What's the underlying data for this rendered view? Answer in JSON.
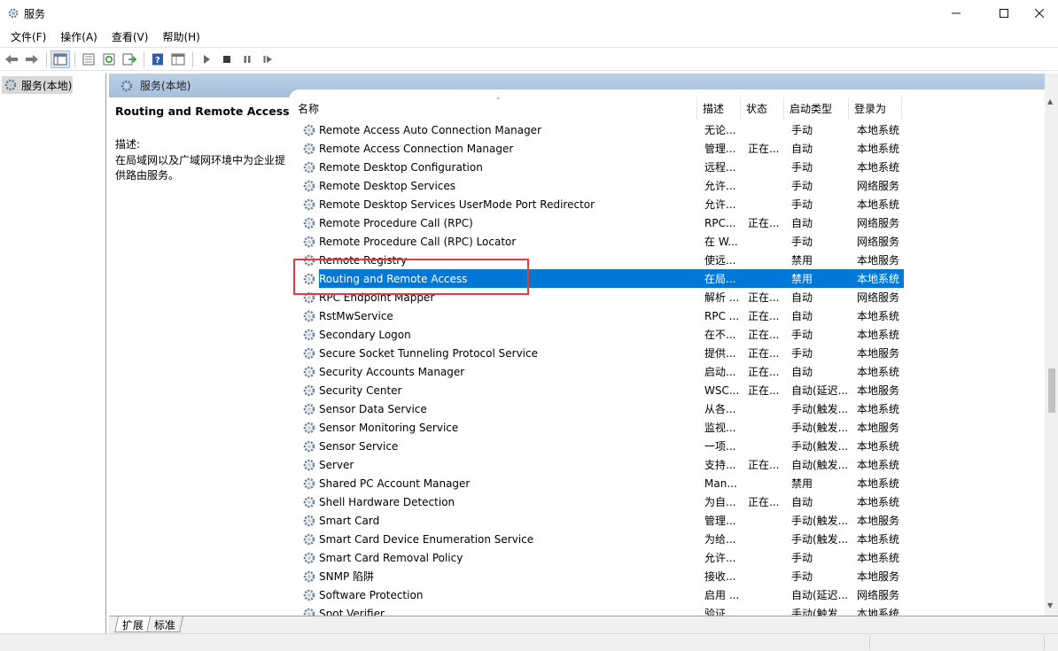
{
  "window": {
    "title": "服务"
  },
  "menu": [
    "文件(F)",
    "操作(A)",
    "查看(V)",
    "帮助(H)"
  ],
  "tree": {
    "root_label": "服务(本地)"
  },
  "pane": {
    "header": "服务(本地)"
  },
  "description": {
    "service_name": "Routing and Remote Access",
    "label": "描述:",
    "text": "在局域网以及广域网环境中为企业提供路由服务。"
  },
  "columns": {
    "name": "名称",
    "desc": "描述",
    "status": "状态",
    "startup": "启动类型",
    "logon": "登录为"
  },
  "services": [
    {
      "name": "Remote Access Auto Connection Manager",
      "desc": "无论...",
      "status": "",
      "startup": "手动",
      "logon": "本地系统"
    },
    {
      "name": "Remote Access Connection Manager",
      "desc": "管理...",
      "status": "正在...",
      "startup": "自动",
      "logon": "本地系统"
    },
    {
      "name": "Remote Desktop Configuration",
      "desc": "远程...",
      "status": "",
      "startup": "手动",
      "logon": "本地系统"
    },
    {
      "name": "Remote Desktop Services",
      "desc": "允许...",
      "status": "",
      "startup": "手动",
      "logon": "网络服务"
    },
    {
      "name": "Remote Desktop Services UserMode Port Redirector",
      "desc": "允许...",
      "status": "",
      "startup": "手动",
      "logon": "本地系统"
    },
    {
      "name": "Remote Procedure Call (RPC)",
      "desc": "RPC...",
      "status": "正在...",
      "startup": "自动",
      "logon": "网络服务"
    },
    {
      "name": "Remote Procedure Call (RPC) Locator",
      "desc": "在 W...",
      "status": "",
      "startup": "手动",
      "logon": "网络服务"
    },
    {
      "name": "Remote Registry",
      "desc": "使远...",
      "status": "",
      "startup": "禁用",
      "logon": "本地服务"
    },
    {
      "name": "Routing and Remote Access",
      "desc": "在局...",
      "status": "",
      "startup": "禁用",
      "logon": "本地系统"
    },
    {
      "name": "RPC Endpoint Mapper",
      "desc": "解析 ...",
      "status": "正在...",
      "startup": "自动",
      "logon": "网络服务"
    },
    {
      "name": "RstMwService",
      "desc": "RPC ...",
      "status": "正在...",
      "startup": "自动",
      "logon": "本地系统"
    },
    {
      "name": "Secondary Logon",
      "desc": "在不...",
      "status": "正在...",
      "startup": "手动",
      "logon": "本地系统"
    },
    {
      "name": "Secure Socket Tunneling Protocol Service",
      "desc": "提供...",
      "status": "正在...",
      "startup": "手动",
      "logon": "本地服务"
    },
    {
      "name": "Security Accounts Manager",
      "desc": "启动...",
      "status": "正在...",
      "startup": "自动",
      "logon": "本地系统"
    },
    {
      "name": "Security Center",
      "desc": "WSC...",
      "status": "正在...",
      "startup": "自动(延迟...",
      "logon": "本地服务"
    },
    {
      "name": "Sensor Data Service",
      "desc": "从各...",
      "status": "",
      "startup": "手动(触发...",
      "logon": "本地系统"
    },
    {
      "name": "Sensor Monitoring Service",
      "desc": "监视...",
      "status": "",
      "startup": "手动(触发...",
      "logon": "本地服务"
    },
    {
      "name": "Sensor Service",
      "desc": "一项...",
      "status": "",
      "startup": "手动(触发...",
      "logon": "本地系统"
    },
    {
      "name": "Server",
      "desc": "支持...",
      "status": "正在...",
      "startup": "自动(触发...",
      "logon": "本地系统"
    },
    {
      "name": "Shared PC Account Manager",
      "desc": "Man...",
      "status": "",
      "startup": "禁用",
      "logon": "本地系统"
    },
    {
      "name": "Shell Hardware Detection",
      "desc": "为自...",
      "status": "正在...",
      "startup": "自动",
      "logon": "本地系统"
    },
    {
      "name": "Smart Card",
      "desc": "管理...",
      "status": "",
      "startup": "手动(触发...",
      "logon": "本地服务"
    },
    {
      "name": "Smart Card Device Enumeration Service",
      "desc": "为给...",
      "status": "",
      "startup": "手动(触发...",
      "logon": "本地系统"
    },
    {
      "name": "Smart Card Removal Policy",
      "desc": "允许...",
      "status": "",
      "startup": "手动",
      "logon": "本地系统"
    },
    {
      "name": "SNMP 陷阱",
      "desc": "接收...",
      "status": "",
      "startup": "手动",
      "logon": "本地服务"
    },
    {
      "name": "Software Protection",
      "desc": "启用 ...",
      "status": "",
      "startup": "自动(延迟...",
      "logon": "网络服务"
    },
    {
      "name": "Spot Verifier",
      "desc": "验证...",
      "status": "",
      "startup": "手动(触发...",
      "logon": "本地系统"
    }
  ],
  "selected_index": 8,
  "tabs": [
    "扩展",
    "标准"
  ]
}
